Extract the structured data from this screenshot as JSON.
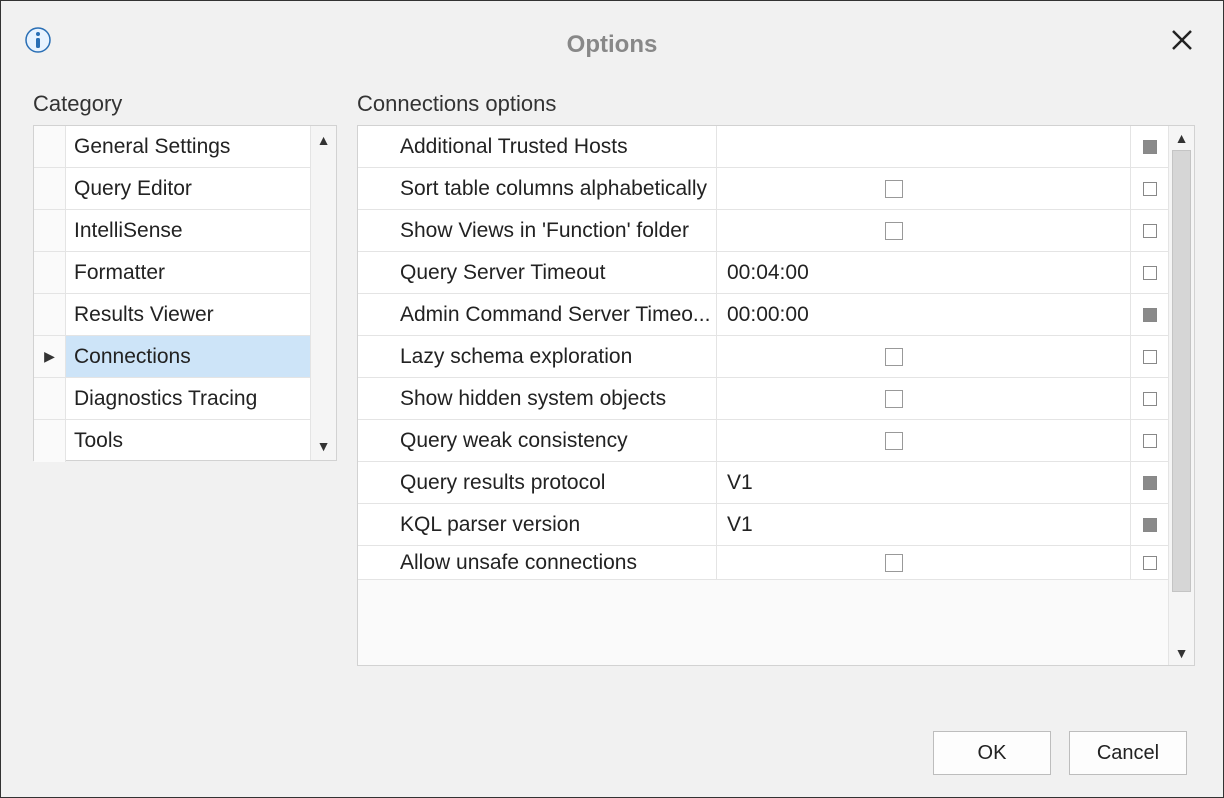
{
  "title": "Options",
  "category_heading": "Category",
  "options_heading": "Connections options",
  "categories": [
    {
      "label": "General Settings",
      "selected": false
    },
    {
      "label": "Query Editor",
      "selected": false
    },
    {
      "label": "IntelliSense",
      "selected": false
    },
    {
      "label": "Formatter",
      "selected": false
    },
    {
      "label": "Results Viewer",
      "selected": false
    },
    {
      "label": "Connections",
      "selected": true
    },
    {
      "label": "Diagnostics Tracing",
      "selected": false
    },
    {
      "label": "Tools",
      "selected": false
    }
  ],
  "options": [
    {
      "name": "Additional Trusted Hosts",
      "value": "",
      "checkbox": false,
      "end_filled": true
    },
    {
      "name": "Sort table columns alphabetically",
      "value": "",
      "checkbox": true,
      "end_filled": false
    },
    {
      "name": "Show Views in 'Function' folder",
      "value": "",
      "checkbox": true,
      "end_filled": false
    },
    {
      "name": "Query Server Timeout",
      "value": "00:04:00",
      "checkbox": false,
      "end_filled": false
    },
    {
      "name": "Admin Command Server Timeo...",
      "value": "00:00:00",
      "checkbox": false,
      "end_filled": true
    },
    {
      "name": "Lazy schema exploration",
      "value": "",
      "checkbox": true,
      "end_filled": false
    },
    {
      "name": "Show hidden system objects",
      "value": "",
      "checkbox": true,
      "end_filled": false
    },
    {
      "name": "Query weak consistency",
      "value": "",
      "checkbox": true,
      "end_filled": false
    },
    {
      "name": "Query results protocol",
      "value": "V1",
      "checkbox": false,
      "end_filled": true
    },
    {
      "name": "KQL parser version",
      "value": "V1",
      "checkbox": false,
      "end_filled": true
    },
    {
      "name": "Allow unsafe connections",
      "value": "",
      "checkbox": true,
      "end_filled": false,
      "clipped": true
    }
  ],
  "buttons": {
    "ok": "OK",
    "cancel": "Cancel"
  }
}
